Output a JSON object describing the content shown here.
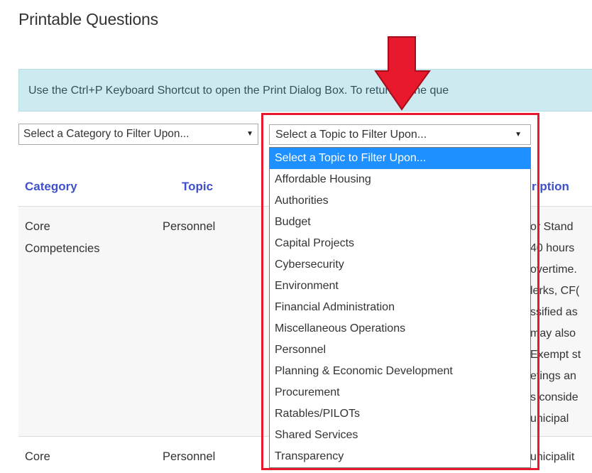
{
  "page": {
    "title": "Printable Questions"
  },
  "banner": {
    "text": "Use the Ctrl+P Keyboard Shortcut to open the Print Dialog Box. To return to the que"
  },
  "filters": {
    "category_select": {
      "value": "Select a Category to Filter Upon...",
      "caret": "▼"
    },
    "topic_select": {
      "value": "Select a Topic to Filter Upon...",
      "caret": "▼"
    }
  },
  "topic_options": [
    "Select a Topic to Filter Upon...",
    "Affordable Housing",
    "Authorities",
    "Budget",
    "Capital Projects",
    "Cybersecurity",
    "Environment",
    "Financial Administration",
    "Miscellaneous Operations",
    "Personnel",
    "Planning & Economic Development",
    "Procurement",
    "Ratables/PILOTs",
    "Shared Services",
    "Transparency"
  ],
  "table": {
    "headers": {
      "category": "Category",
      "topic": "Topic",
      "description": "ription"
    },
    "rows": [
      {
        "category_line1": "Core",
        "category_line2": "Competencies",
        "topic": "Personnel",
        "description_fragments": [
          "or Stand",
          "40 hours",
          "overtime.",
          "lerks, CF(",
          "ssified as",
          "may also",
          "Exempt st",
          "etings an",
          "s conside",
          "unicipal"
        ]
      },
      {
        "category_line1": "Core",
        "topic": "Personnel",
        "description_fragments": [
          "unicipalit"
        ]
      }
    ]
  },
  "annotation": {
    "highlight_color": "#e8192c",
    "arrow_color": "#e8192c"
  }
}
